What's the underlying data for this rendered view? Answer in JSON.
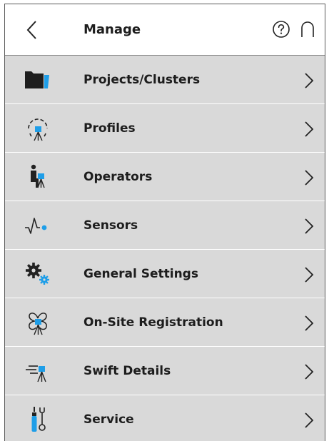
{
  "header": {
    "title": "Manage"
  },
  "accent_color": "#1e9ee8",
  "menu": {
    "items": [
      {
        "label": "Projects/Clusters",
        "icon": "folder-icon"
      },
      {
        "label": "Profiles",
        "icon": "profile-scanner-icon"
      },
      {
        "label": "Operators",
        "icon": "operator-icon"
      },
      {
        "label": "Sensors",
        "icon": "sensor-wave-icon"
      },
      {
        "label": "General Settings",
        "icon": "gears-icon"
      },
      {
        "label": "On-Site Registration",
        "icon": "registration-icon"
      },
      {
        "label": "Swift Details",
        "icon": "swift-scanner-icon"
      },
      {
        "label": "Service",
        "icon": "service-tools-icon"
      }
    ]
  }
}
